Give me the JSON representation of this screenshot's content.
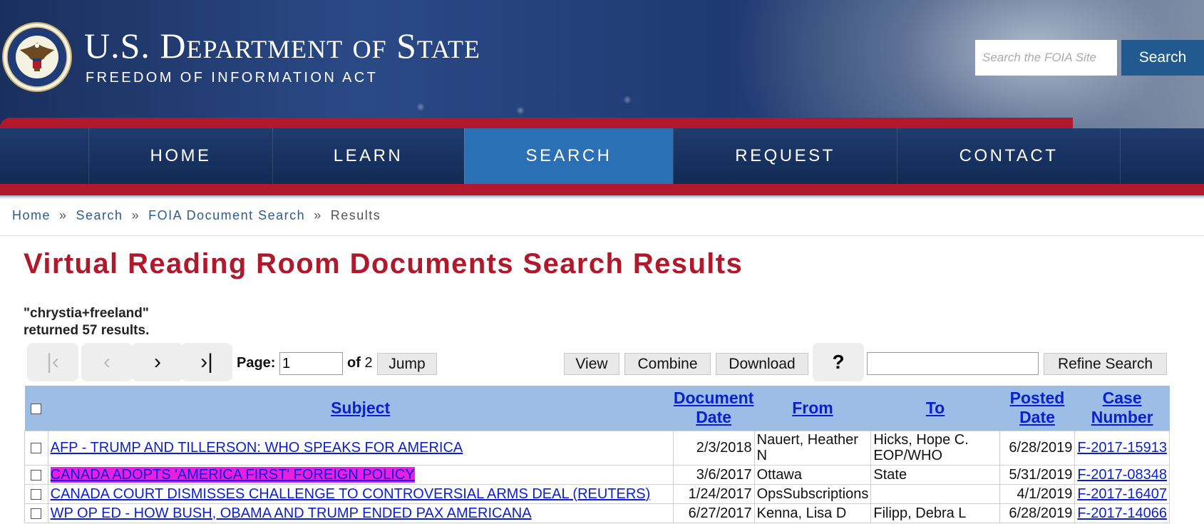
{
  "header": {
    "agency_name_parts": [
      "U.S. D",
      "EPARTMENT",
      " OF ",
      "S",
      "TATE"
    ],
    "agency_name": "U.S. DEPARTMENT OF STATE",
    "subtitle": "FREEDOM OF INFORMATION ACT",
    "search_placeholder": "Search the FOIA Site",
    "search_button": "Search",
    "seal_icon": "state-department-seal-icon"
  },
  "nav": {
    "items": [
      {
        "label": "HOME"
      },
      {
        "label": "LEARN"
      },
      {
        "label": "SEARCH",
        "active": true
      },
      {
        "label": "REQUEST"
      },
      {
        "label": "CONTACT"
      }
    ]
  },
  "breadcrumb": {
    "items": [
      "Home",
      "Search",
      "FOIA Document Search",
      "Results"
    ],
    "separator": "»"
  },
  "page": {
    "title": "Virtual Reading Room Documents Search Results",
    "query": "\"chrystia+freeland\"",
    "result_summary": "returned 57 results."
  },
  "toolbar": {
    "first_label": "|‹",
    "prev_label": "‹",
    "next_label": "›",
    "last_label": "›|",
    "page_label": "Page:",
    "page_value": "1",
    "of_label": "of",
    "total_pages": "2",
    "jump_label": "Jump",
    "view_label": "View",
    "combine_label": "Combine",
    "download_label": "Download",
    "help_label": "?",
    "refine_value": "",
    "refine_label": "Refine Search"
  },
  "table": {
    "headers": {
      "subject": "Subject",
      "document_date": "Document Date",
      "from": "From",
      "to": "To",
      "posted_date": "Posted Date",
      "case_number": "Case Number"
    },
    "rows": [
      {
        "subject": "AFP - TRUMP AND TILLERSON: WHO SPEAKS FOR AMERICA",
        "document_date": "2/3/2018",
        "from": "Nauert, Heather N",
        "to": "Hicks, Hope C. EOP/WHO",
        "posted_date": "6/28/2019",
        "case_number": "F-2017-15913"
      },
      {
        "subject": "CANADA ADOPTS 'AMERICA FIRST' FOREIGN POLICY",
        "document_date": "3/6/2017",
        "from": "Ottawa",
        "to": "State",
        "posted_date": "5/31/2019",
        "case_number": "F-2017-08348",
        "highlighted": true
      },
      {
        "subject": "CANADA COURT DISMISSES CHALLENGE TO CONTROVERSIAL ARMS DEAL (REUTERS)",
        "document_date": "1/24/2017",
        "from": "OpsSubscriptions",
        "to": "",
        "posted_date": "4/1/2019",
        "case_number": "F-2017-16407"
      },
      {
        "subject": "WP OP ED - HOW BUSH, OBAMA AND TRUMP ENDED PAX AMERICANA",
        "document_date": "6/27/2017",
        "from": "Kenna, Lisa D",
        "to": "Filipp, Debra L",
        "posted_date": "6/28/2019",
        "case_number": "F-2017-14066"
      }
    ]
  }
}
